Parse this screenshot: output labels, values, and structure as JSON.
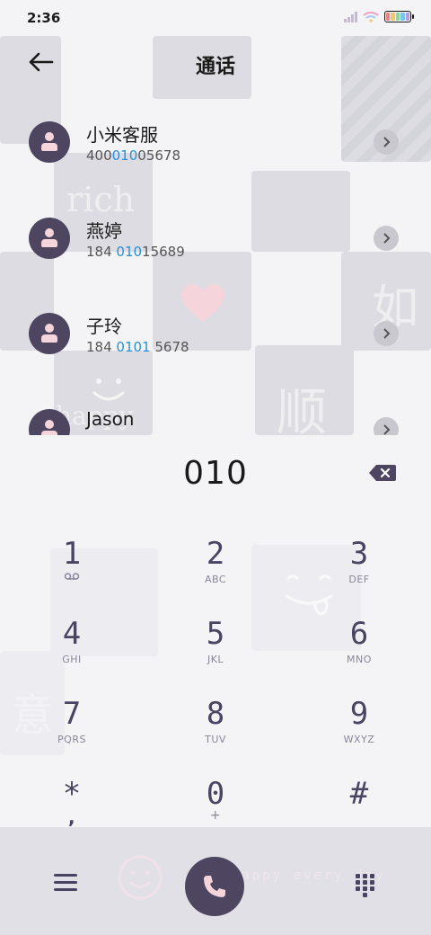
{
  "status": {
    "time": "2:36",
    "battery_colors": [
      "#f08080",
      "#f6c46a",
      "#8fd68f",
      "#7cc4f0",
      "#b49ae6"
    ]
  },
  "header": {
    "title": "通话"
  },
  "results": [
    {
      "name": "小米客服",
      "number_parts": [
        "400",
        "010",
        "05678"
      ]
    },
    {
      "name": "燕婷",
      "number_parts": [
        "184 ",
        "010",
        "15689"
      ]
    },
    {
      "name": "子玲",
      "number_parts": [
        "184 ",
        "0101",
        " 5678"
      ]
    },
    {
      "name": "Jason",
      "number_parts": [
        "",
        "",
        ""
      ]
    }
  ],
  "dialer": {
    "input": "010",
    "keys": [
      {
        "digit": "1",
        "letters": ""
      },
      {
        "digit": "2",
        "letters": "ABC"
      },
      {
        "digit": "3",
        "letters": "DEF"
      },
      {
        "digit": "4",
        "letters": "GHI"
      },
      {
        "digit": "5",
        "letters": "JKL"
      },
      {
        "digit": "6",
        "letters": "MNO"
      },
      {
        "digit": "7",
        "letters": "PQRS"
      },
      {
        "digit": "8",
        "letters": "TUV"
      },
      {
        "digit": "9",
        "letters": "WXYZ"
      },
      {
        "digit": "*",
        "letters": ","
      },
      {
        "digit": "0",
        "letters": "+"
      },
      {
        "digit": "#",
        "letters": ""
      }
    ]
  },
  "decorations": {
    "rich": "rich",
    "ru": "如",
    "shun": "顺",
    "yi": "意",
    "happy": "happy",
    "bottom_text": "happy every day"
  },
  "colors": {
    "accent": "#4e4660",
    "highlight": "#2a8fd8"
  }
}
